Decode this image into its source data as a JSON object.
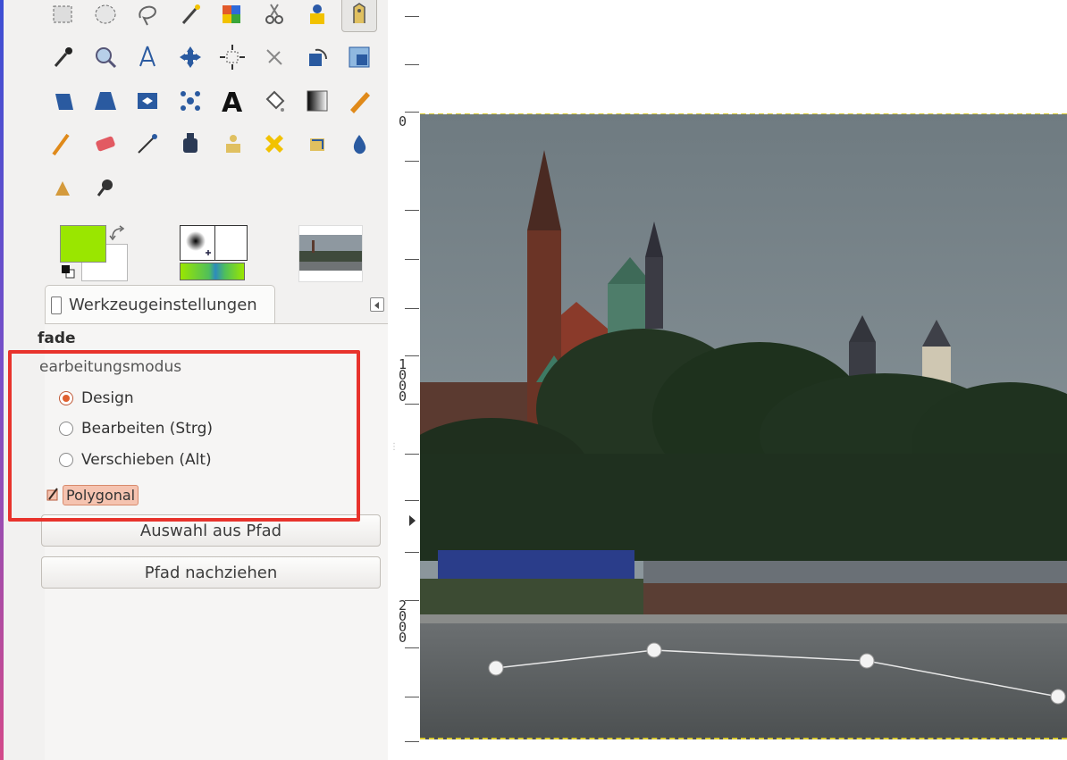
{
  "toolbox": {
    "tools": [
      {
        "icon": "rect-select-icon",
        "active": false
      },
      {
        "icon": "ellipse-select-icon",
        "active": false
      },
      {
        "icon": "free-select-icon",
        "active": false
      },
      {
        "icon": "fuzzy-select-icon",
        "active": false
      },
      {
        "icon": "color-select-icon",
        "active": false
      },
      {
        "icon": "scissors-select-icon",
        "active": false
      },
      {
        "icon": "foreground-select-icon",
        "active": false
      },
      {
        "icon": "paths-tool-icon",
        "active": true
      },
      {
        "icon": "color-picker-icon",
        "active": false
      },
      {
        "icon": "zoom-icon",
        "active": false
      },
      {
        "icon": "measure-icon",
        "active": false
      },
      {
        "icon": "move-icon",
        "active": false
      },
      {
        "icon": "align-icon",
        "active": false
      },
      {
        "icon": "crop-icon",
        "active": false
      },
      {
        "icon": "rotate-icon",
        "active": false
      },
      {
        "icon": "scale-icon",
        "active": false
      },
      {
        "icon": "shear-icon",
        "active": false
      },
      {
        "icon": "perspective-icon",
        "active": false
      },
      {
        "icon": "flip-icon",
        "active": false
      },
      {
        "icon": "cage-transform-icon",
        "active": false
      },
      {
        "icon": "text-tool-icon",
        "active": false
      },
      {
        "icon": "bucket-fill-icon",
        "active": false
      },
      {
        "icon": "blend-icon",
        "active": false
      },
      {
        "icon": "pencil-icon",
        "active": false
      },
      {
        "icon": "paintbrush-icon",
        "active": false
      },
      {
        "icon": "eraser-icon",
        "active": false
      },
      {
        "icon": "airbrush-icon",
        "active": false
      },
      {
        "icon": "ink-icon",
        "active": false
      },
      {
        "icon": "clone-icon",
        "active": false
      },
      {
        "icon": "heal-icon",
        "active": false
      },
      {
        "icon": "perspective-clone-icon",
        "active": false
      },
      {
        "icon": "blur-sharpen-icon",
        "active": false
      },
      {
        "icon": "smudge-icon",
        "active": false
      },
      {
        "icon": "dodge-burn-icon",
        "active": false
      }
    ],
    "colors": {
      "foreground": "#9ae600",
      "background": "#ffffff"
    }
  },
  "tool_options": {
    "tab_label": "Werkzeugeinstellungen",
    "section_title": "fade",
    "mode_label": "earbeitungsmodus",
    "modes": [
      {
        "label": "Design",
        "checked": true
      },
      {
        "label": "Bearbeiten (Strg)",
        "checked": false
      },
      {
        "label": "Verschieben (Alt)",
        "checked": false
      }
    ],
    "polygonal_label": "Polygonal",
    "buttons": {
      "selection_from_path": "Auswahl aus Pfad",
      "stroke_path": "Pfad nachziehen"
    },
    "highlight_color": "#e8332c"
  },
  "ruler": {
    "labels": [
      {
        "text": "0"
      },
      {
        "text": "1\n0\n0\n0"
      },
      {
        "text": "2\n0\n0\n0"
      }
    ]
  },
  "canvas": {
    "guide_color": "#d7c82d"
  }
}
